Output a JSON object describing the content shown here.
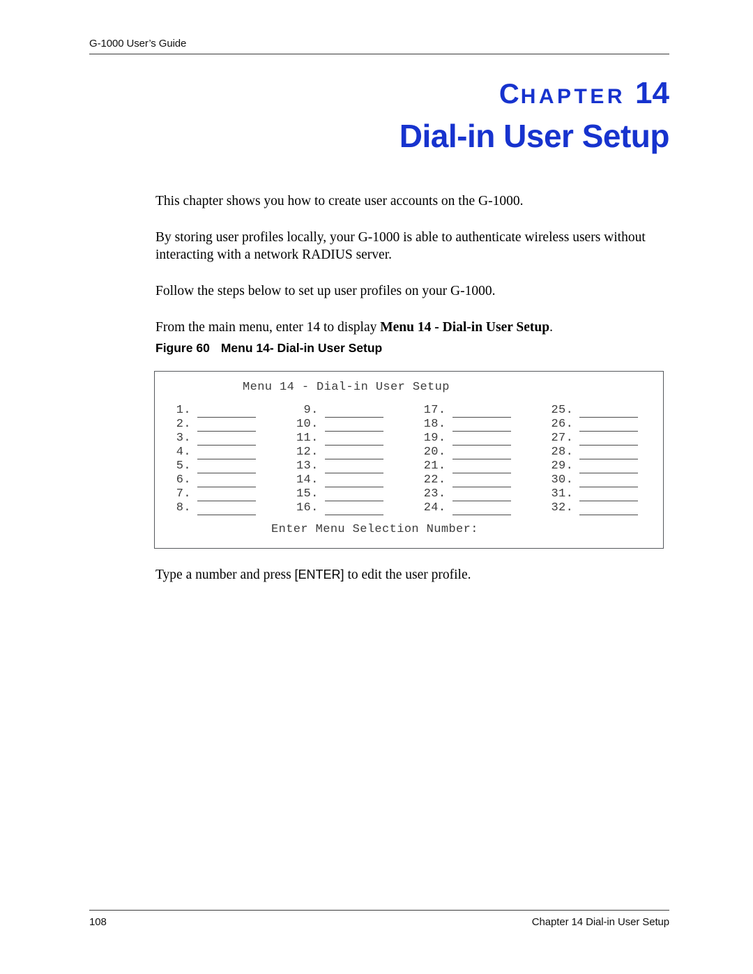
{
  "header": {
    "running_title": "G-1000 User’s Guide"
  },
  "chapter": {
    "label_first_letter": "C",
    "label_rest": "HAPTER",
    "number": "14",
    "title": "Dial-in User Setup"
  },
  "body": {
    "paragraph_1": "This chapter shows you how to create user accounts on the G-1000.",
    "paragraph_2": "By storing user profiles locally, your G-1000 is able to authenticate wireless users without interacting with a network RADIUS server.",
    "paragraph_3": "Follow the steps below to set up user profiles on your G-1000.",
    "paragraph_4_prefix": "From the main menu, enter 14 to display ",
    "paragraph_4_bold": "Menu 14 - Dial-in User Setup",
    "paragraph_4_suffix": ".",
    "after_figure_prefix": "Type a number and press ",
    "after_figure_key": "[ENTER]",
    "after_figure_suffix": " to edit the user profile."
  },
  "figure": {
    "caption_label": "Figure 60",
    "caption_text": "Menu 14- Dial-in User Setup"
  },
  "menu_screen": {
    "title": "Menu 14 - Dial-in User Setup",
    "prompt": "Enter Menu Selection Number:",
    "rows": [
      [
        "1.",
        "9.",
        "17.",
        "25."
      ],
      [
        "2.",
        "10.",
        "18.",
        "26."
      ],
      [
        "3.",
        "11.",
        "19.",
        "27."
      ],
      [
        "4.",
        "12.",
        "20.",
        "28."
      ],
      [
        "5.",
        "13.",
        "21.",
        "29."
      ],
      [
        "6.",
        "14.",
        "22.",
        "30."
      ],
      [
        "7.",
        "15.",
        "23.",
        "31."
      ],
      [
        "8.",
        "16.",
        "24.",
        "32."
      ]
    ]
  },
  "footer": {
    "page_number": "108",
    "chapter_reference": "Chapter 14 Dial-in User Setup"
  },
  "colors": {
    "heading_blue": "#1733CE",
    "rule_gray": "#3a3a3a",
    "terminal_text": "#3c3c3c"
  }
}
